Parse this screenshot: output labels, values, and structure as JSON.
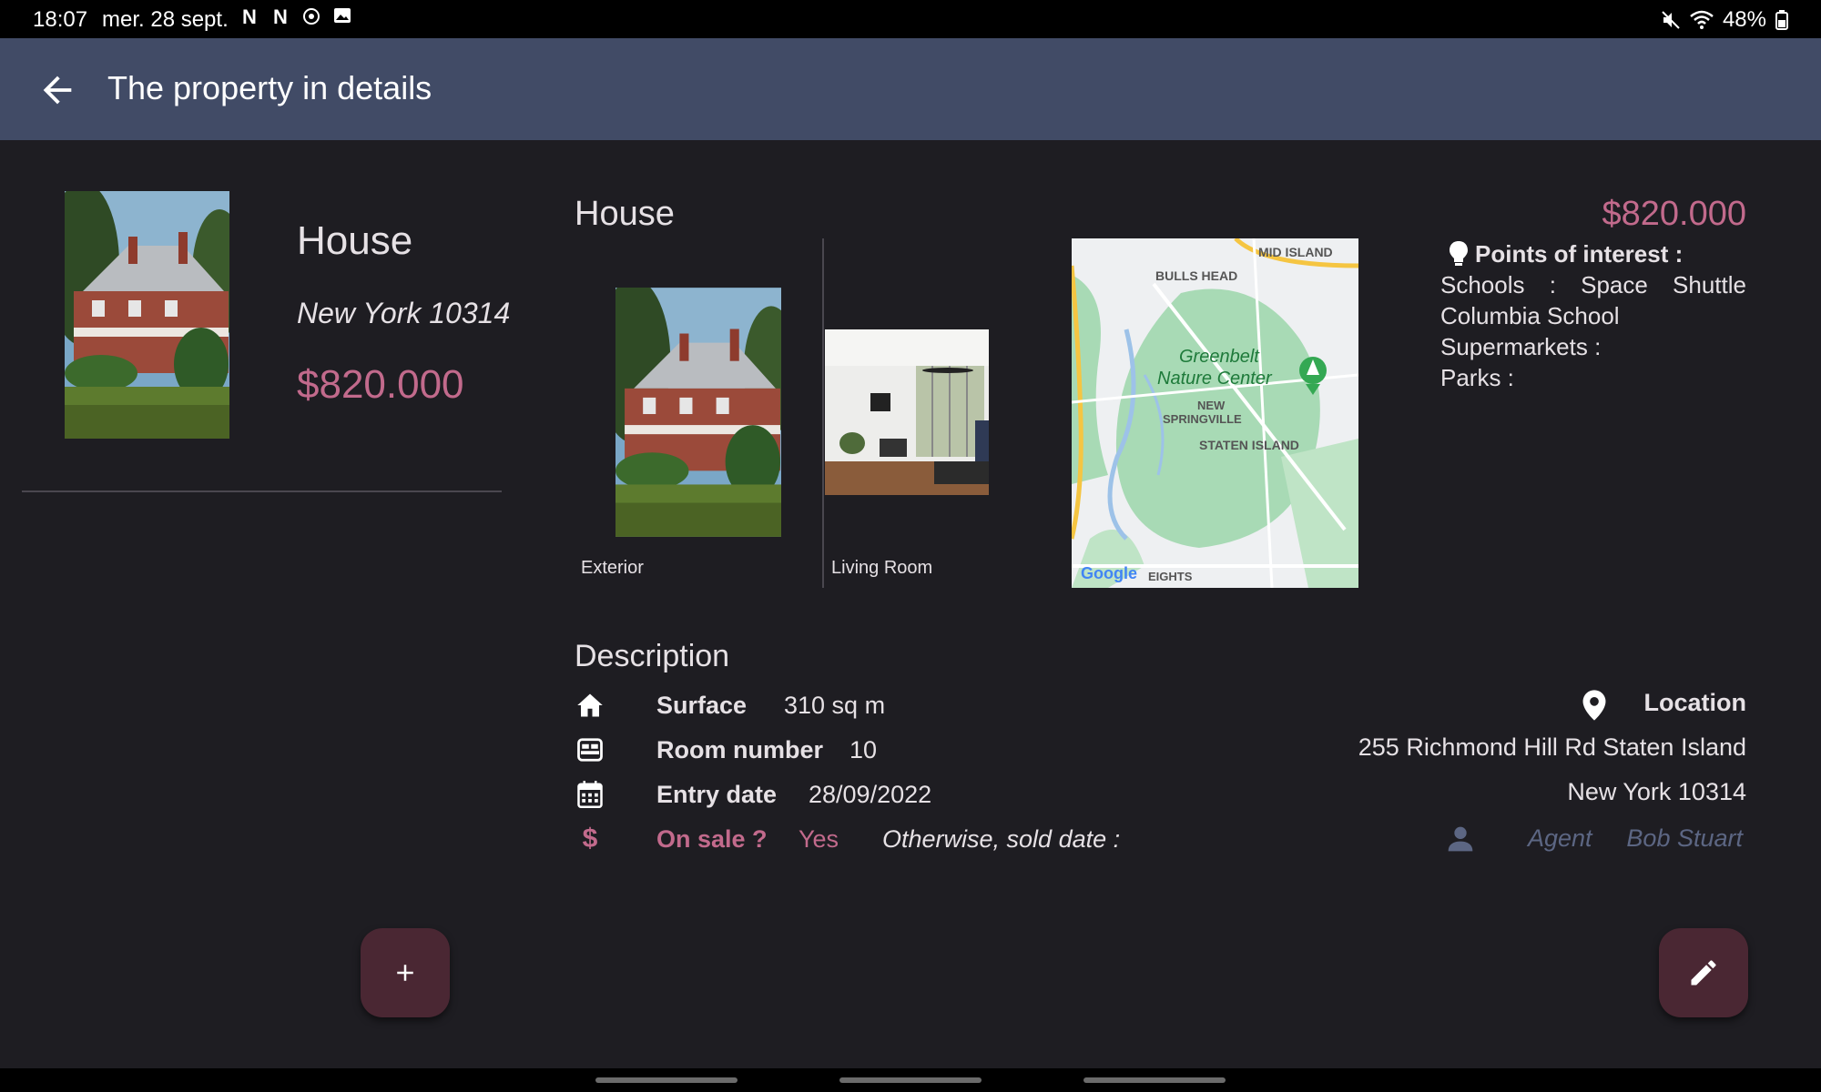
{
  "status_bar": {
    "time": "18:07",
    "date": "mer. 28 sept.",
    "battery": "48%",
    "notification_icons": [
      "netflix-icon",
      "netflix-icon",
      "target-icon",
      "image-icon"
    ],
    "right_icons": [
      "mute-icon",
      "wifi-icon",
      "battery-icon"
    ]
  },
  "app_bar": {
    "title": "The property in details"
  },
  "summary": {
    "type": "House",
    "city": "New York 10314",
    "price": "$820.000"
  },
  "detail": {
    "type": "House",
    "price": "$820.000",
    "photos": [
      {
        "label": "Exterior"
      },
      {
        "label": "Living Room"
      }
    ],
    "map_labels": [
      "MID ISLAND",
      "BULLS HEAD",
      "Greenbelt",
      "Nature Center",
      "NEW",
      "SPRINGVILLE",
      "STATEN ISLAND",
      "EIGHTS",
      "Google"
    ],
    "points_of_interest": {
      "title": "Points of interest :",
      "schools_label": "Schools",
      "schools_sep": ":",
      "schools_value_1": "Space",
      "schools_value_2": "Shuttle",
      "schools_value_3": "Columbia School",
      "supermarkets": "Supermarkets :",
      "parks": "Parks :"
    }
  },
  "description": {
    "title": "Description",
    "surface_label": "Surface",
    "surface_value": "310 sq m",
    "rooms_label": "Room number",
    "rooms_value": "10",
    "entry_label": "Entry date",
    "entry_value": "28/09/2022",
    "sale_label": "On sale ?",
    "sale_value": "Yes",
    "sold_label": "Otherwise, sold date :",
    "location_label": "Location",
    "address_line1": "255 Richmond Hill Rd Staten Island",
    "address_line2": "New York 10314",
    "agent_label": "Agent",
    "agent_name": "Bob Stuart"
  },
  "colors": {
    "accent": "#c26a8c",
    "app_bar": "#414b66",
    "background": "#1e1d22",
    "agent_text": "#5c6683",
    "fab": "#4a2733"
  }
}
